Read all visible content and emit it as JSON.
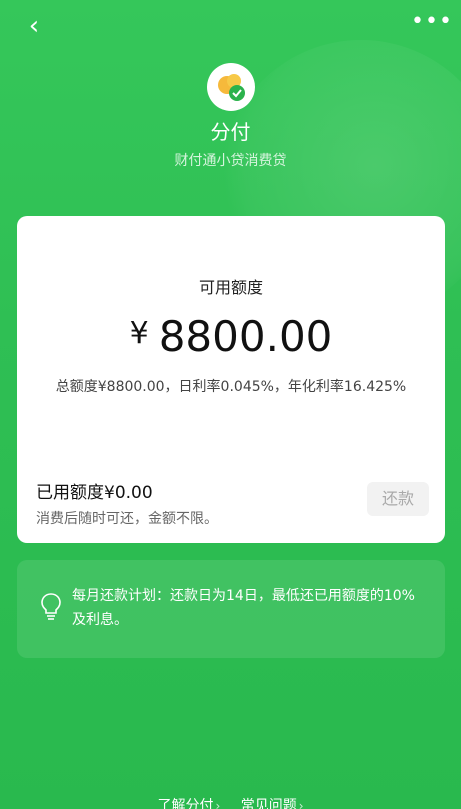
{
  "header": {
    "back_icon": "chevron-left",
    "more_icon": "ellipsis-horizontal"
  },
  "brand": {
    "logo": "fenfu-logo",
    "title": "分付",
    "subtitle": "财付通小贷消费贷"
  },
  "credit_card": {
    "available_label": "可用额度",
    "currency": "¥",
    "available_amount": "8800.00",
    "info": "总额度¥8800.00，日利率0.045%，年化利率16.425%",
    "used_label": "已用额度¥0.00",
    "used_note": "消费后随时可还，金额不限。",
    "repay_button": "还款"
  },
  "plan": {
    "icon": "lightbulb-icon",
    "text": "每月还款计划：还款日为14日，最低还已用额度的10%及利息。"
  },
  "footer": {
    "links": [
      "了解分付",
      "常见问题"
    ]
  },
  "colors": {
    "background": "#2fbf54",
    "card": "#ffffff",
    "primary_text": "#111111"
  }
}
